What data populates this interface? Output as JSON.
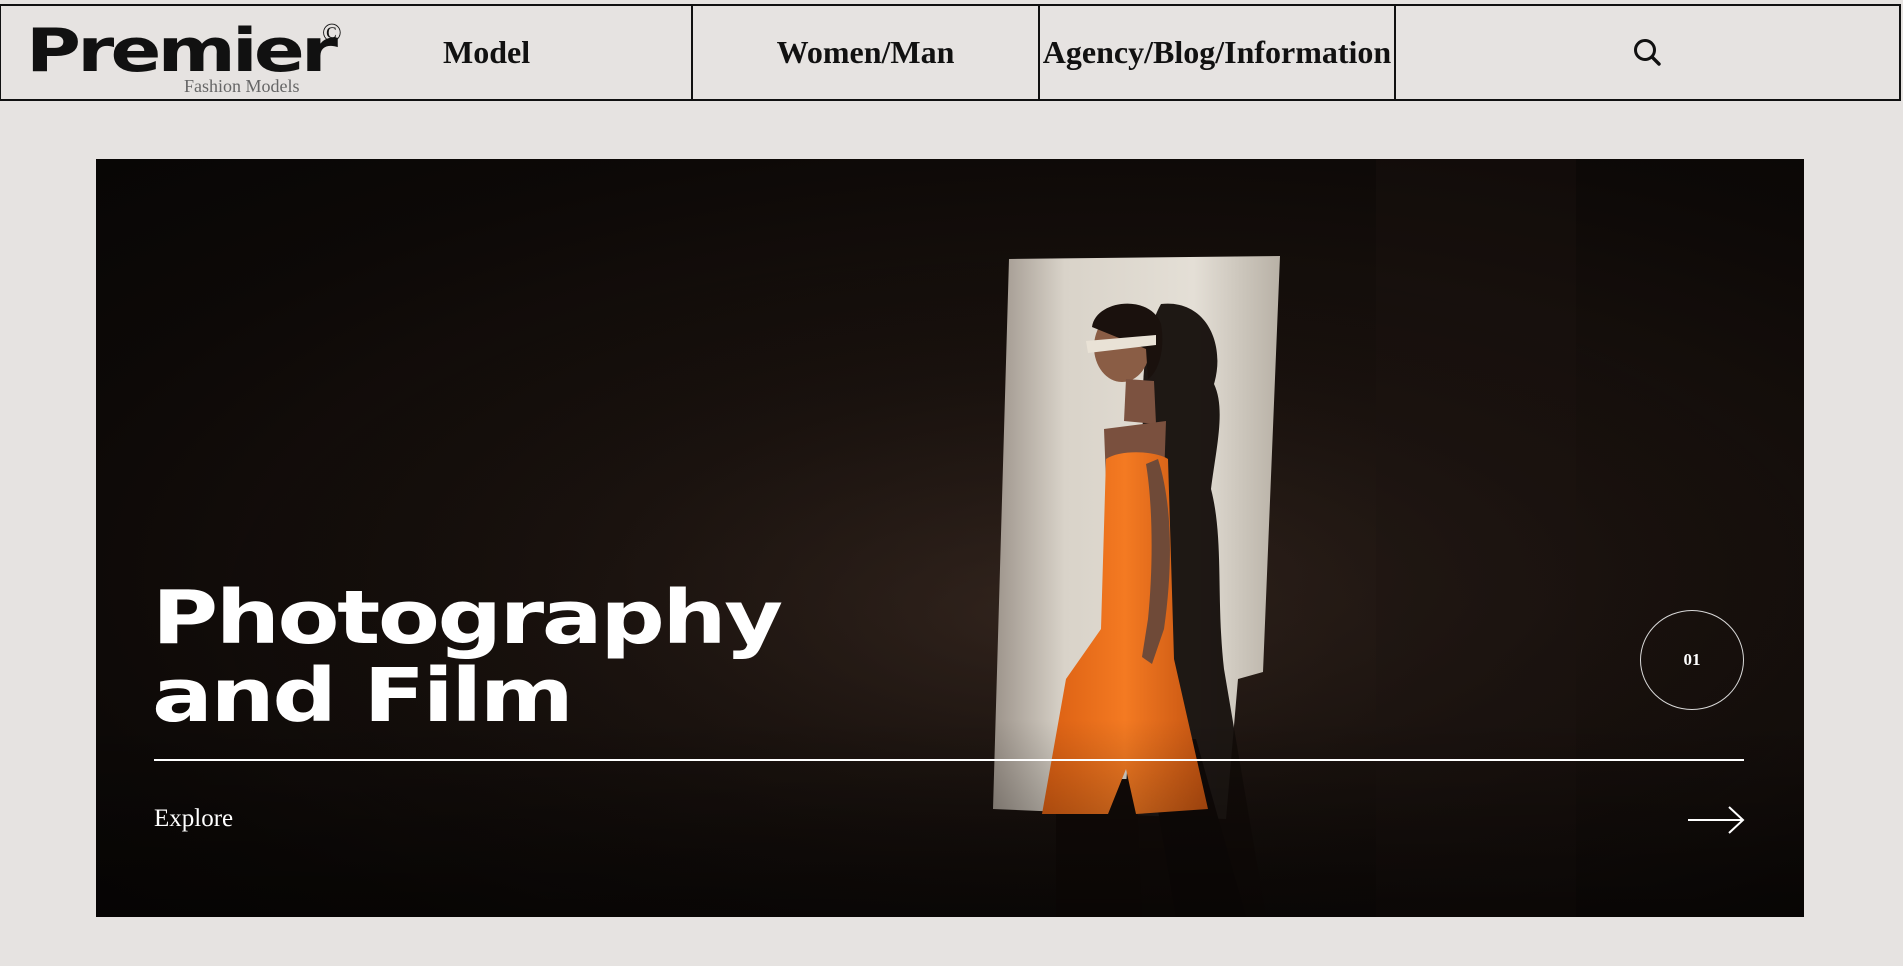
{
  "brand": {
    "name": "Premier",
    "copyright_mark": "©",
    "tagline": "Fashion Models"
  },
  "nav": {
    "model": "Model",
    "women_man": "Women/Man",
    "agency_blog_info": "Agency/Blog/Information",
    "search_icon": "search-icon"
  },
  "hero": {
    "title_line1": "Photography",
    "title_line2": "and Film",
    "slide_number": "01",
    "cta_label": "Explore",
    "cta_icon": "arrow-right-icon"
  },
  "colors": {
    "page_background": "#e6e3e1",
    "hero_background": "#0d0907",
    "dress_orange": "#f0721e",
    "text_dark": "#111111",
    "text_light": "#ffffff"
  }
}
